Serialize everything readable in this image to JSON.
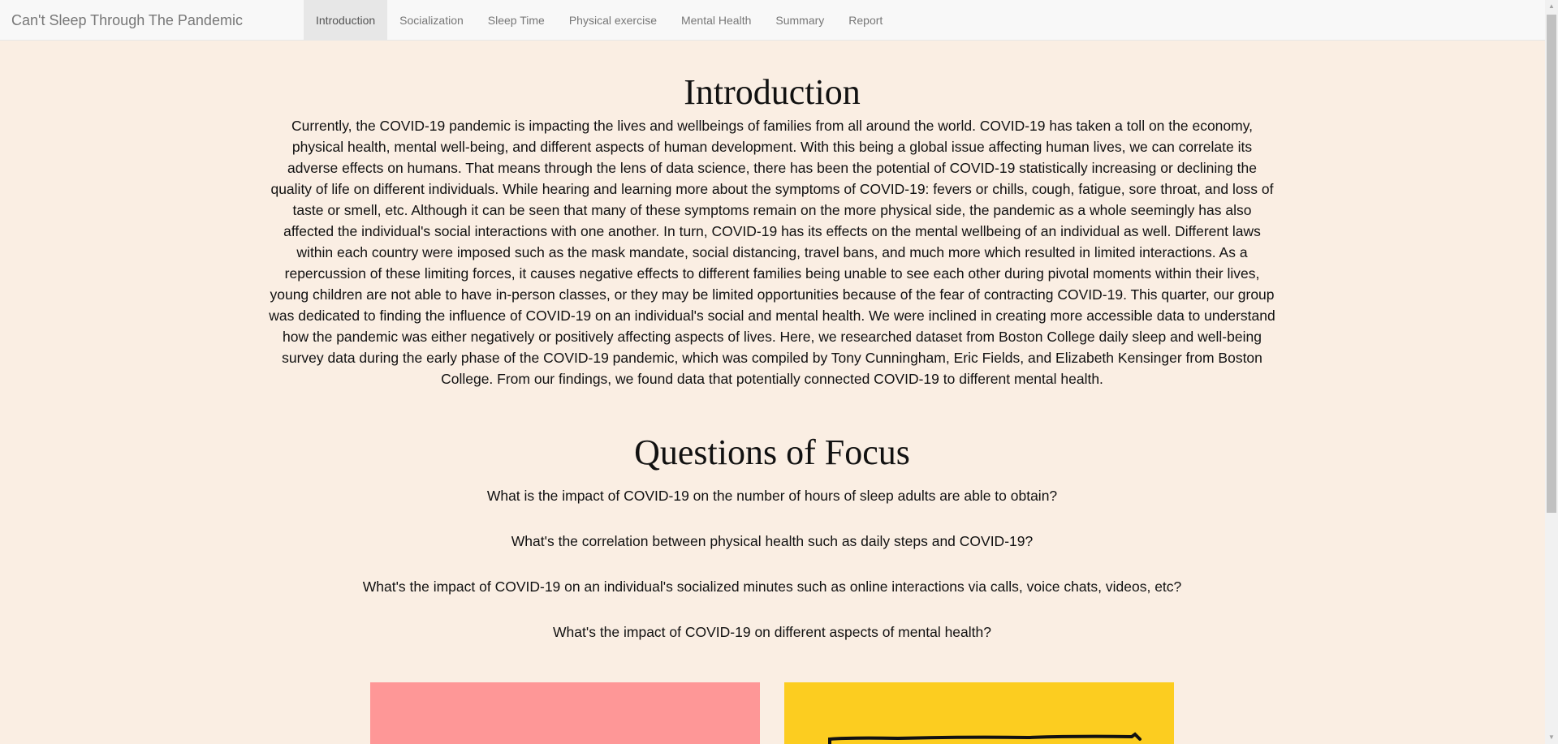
{
  "navbar": {
    "brand": "Can't Sleep Through The Pandemic",
    "tabs": [
      {
        "label": "Introduction",
        "active": true
      },
      {
        "label": "Socialization",
        "active": false
      },
      {
        "label": "Sleep Time",
        "active": false
      },
      {
        "label": "Physical exercise",
        "active": false
      },
      {
        "label": "Mental Health",
        "active": false
      },
      {
        "label": "Summary",
        "active": false
      },
      {
        "label": "Report",
        "active": false
      }
    ]
  },
  "main": {
    "title": "Introduction",
    "intro_text": "Currently, the COVID-19 pandemic is impacting the lives and wellbeings of families from all around the world. COVID-19 has taken a toll on the economy, physical health, mental well-being, and different aspects of human development. With this being a global issue affecting human lives, we can correlate its adverse effects on humans. That means through the lens of data science, there has been the potential of COVID-19 statistically increasing or declining the quality of life on different individuals. While hearing and learning more about the symptoms of COVID-19: fevers or chills, cough, fatigue, sore throat, and loss of taste or smell, etc. Although it can be seen that many of these symptoms remain on the more physical side, the pandemic as a whole seemingly has also affected the individual's social interactions with one another. In turn, COVID-19 has its effects on the mental wellbeing of an individual as well. Different laws within each country were imposed such as the mask mandate, social distancing, travel bans, and much more which resulted in limited interactions. As a repercussion of these limiting forces, it causes negative effects to different families being unable to see each other during pivotal moments within their lives, young children are not able to have in-person classes, or they may be limited opportunities because of the fear of contracting COVID-19. This quarter, our group was dedicated to finding the influence of COVID-19 on an individual's social and mental health. We were inclined in creating more accessible data to understand how the pandemic was either negatively or positively affecting aspects of lives. Here, we researched dataset from Boston College daily sleep and well-being survey data during the early phase of the COVID-19 pandemic, which was compiled by Tony Cunningham, Eric Fields, and Elizabeth Kensinger from Boston College. From our findings, we found data that potentially connected COVID-19 to different mental health.",
    "focus_title": "Questions of Focus",
    "questions": [
      "What is the impact of COVID-19 on the number of hours of sleep adults are able to obtain?",
      "What's the correlation between physical health such as daily steps and COVID-19?",
      "What's the impact of COVID-19 on an individual's socialized minutes such as online interactions via calls, voice chats, videos, etc?",
      "What's the impact of COVID-19 on different aspects of mental health?"
    ]
  },
  "colors": {
    "page_background": "#faeee3",
    "image_left_background": "#fe9797",
    "image_right_background": "#fccd20"
  }
}
